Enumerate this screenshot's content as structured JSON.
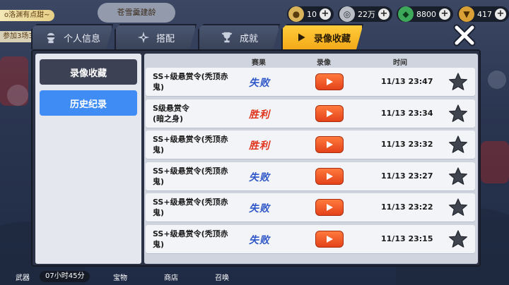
{
  "top": {
    "ticker_text": "o洛渊有点甜~",
    "ticker2_text": "参加3场3",
    "event_banner": "苍雪羹建龄",
    "resources": [
      {
        "icon": "coin-bag-icon",
        "value": "10",
        "color": "#d9b45a"
      },
      {
        "icon": "ryo-coin-icon",
        "value": "22万",
        "color": "#b9bdc6"
      },
      {
        "icon": "jade-icon",
        "value": "8800",
        "color": "#3ea85a"
      },
      {
        "icon": "gold-pin-icon",
        "value": "417",
        "color": "#d9a035"
      }
    ]
  },
  "tabs": [
    {
      "label": "个人信息",
      "icon": "ninja-head-icon",
      "active": false
    },
    {
      "label": "搭配",
      "icon": "shuriken-icon",
      "active": false
    },
    {
      "label": "成就",
      "icon": "trophy-icon",
      "active": false
    },
    {
      "label": "录像收藏",
      "icon": "play-icon",
      "active": true
    }
  ],
  "sidebar": {
    "items": [
      {
        "label": "录像收藏"
      },
      {
        "label": "历史纪录"
      }
    ]
  },
  "table": {
    "headers": {
      "mode": "赛果",
      "replay": "录像",
      "time": "时间"
    },
    "rows": [
      {
        "mode": "SS+级悬赏令(秃顶赤鬼)",
        "result": "失败",
        "outcome": "lose",
        "time": "11/13 23:47"
      },
      {
        "mode": "S级悬赏令\n(暗之身)",
        "result": "胜利",
        "outcome": "win",
        "time": "11/13 23:34"
      },
      {
        "mode": "SS+级悬赏令(秃顶赤鬼)",
        "result": "胜利",
        "outcome": "win",
        "time": "11/13 23:32"
      },
      {
        "mode": "SS+级悬赏令(秃顶赤鬼)",
        "result": "失败",
        "outcome": "lose",
        "time": "11/13 23:27"
      },
      {
        "mode": "SS+级悬赏令(秃顶赤鬼)",
        "result": "失败",
        "outcome": "lose",
        "time": "11/13 23:22"
      },
      {
        "mode": "SS+级悬赏令(秃顶赤鬼)",
        "result": "失败",
        "outcome": "lose",
        "time": "11/13 23:15"
      }
    ]
  },
  "bottom": {
    "timer": "07小时45分",
    "items": [
      "武器",
      "宝物",
      "商店",
      "召唤"
    ]
  },
  "colors": {
    "tab_active": "#f3a919",
    "sidebar_selected": "#3f8cf5",
    "lose_text": "#2f57c8",
    "win_text": "#e0341c",
    "play_button": "#e4421a"
  }
}
